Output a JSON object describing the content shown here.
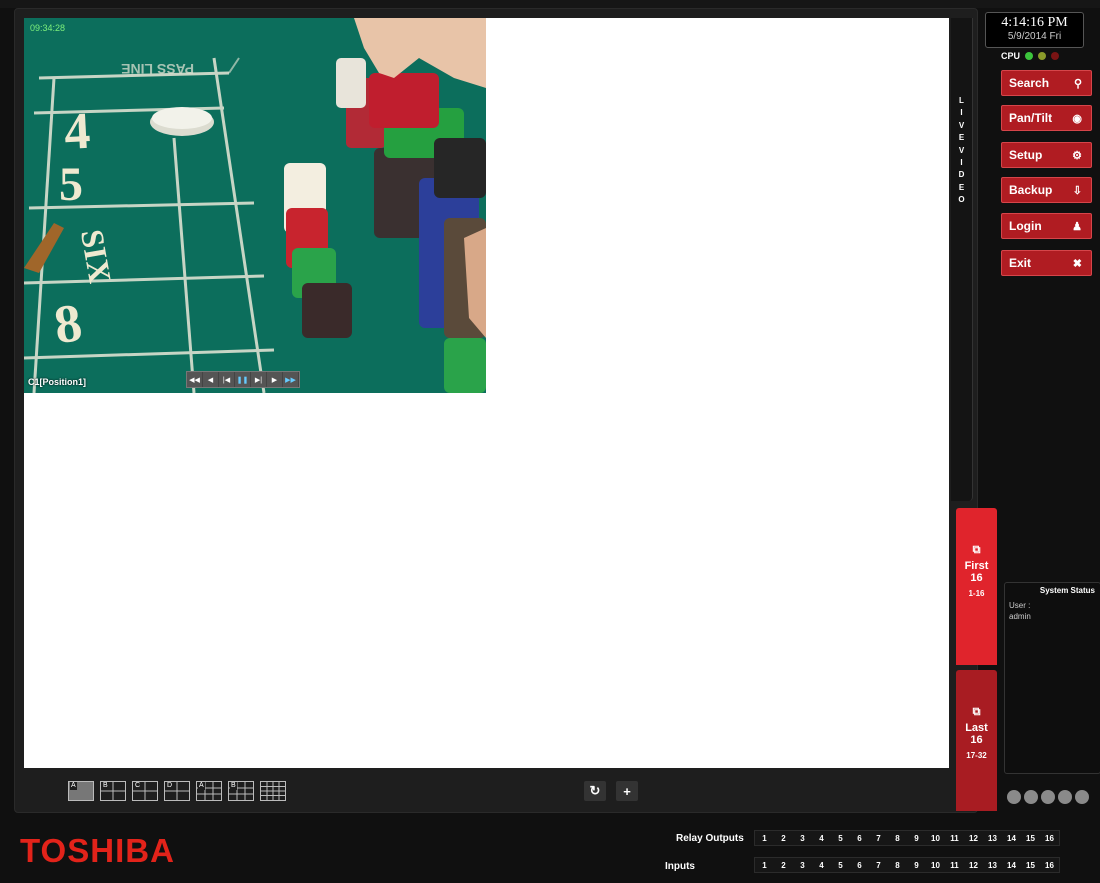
{
  "camera": {
    "timestamp": "09:34:28",
    "label": "C1[Position1]",
    "playback_controls": [
      {
        "icon": "fast-rewind-icon",
        "glyph": "◀◀"
      },
      {
        "icon": "play-reverse-icon",
        "glyph": "◀"
      },
      {
        "icon": "step-back-icon",
        "glyph": "|◀"
      },
      {
        "icon": "pause-icon",
        "glyph": "❚❚"
      },
      {
        "icon": "step-forward-icon",
        "glyph": "▶|"
      },
      {
        "icon": "play-icon",
        "glyph": "▶"
      },
      {
        "icon": "fast-forward-icon",
        "glyph": "▶▶"
      }
    ]
  },
  "live_label": "L I V E V I D E O",
  "clock": {
    "time": "4:14:16 PM",
    "date": "5/9/2014 Fri"
  },
  "cpu": {
    "label": "CPU",
    "leds": [
      "#3cc43c",
      "#8a9a2a",
      "#7a1414"
    ]
  },
  "menu": [
    {
      "label": "Search",
      "icon": "search-icon",
      "glyph": "⚲"
    },
    {
      "label": "Pan/Tilt",
      "icon": "eye-icon",
      "glyph": "◉"
    },
    {
      "label": "Setup",
      "icon": "gear-icon",
      "glyph": "⚙"
    },
    {
      "label": "Backup",
      "icon": "download-icon",
      "glyph": "⇩"
    },
    {
      "label": "Login",
      "icon": "user-icon",
      "glyph": "♟"
    },
    {
      "label": "Exit",
      "icon": "close-icon",
      "glyph": "✖"
    }
  ],
  "pages": {
    "first": {
      "title": "First",
      "count": "16",
      "range": "1-16",
      "icon": "page-stack-icon"
    },
    "last": {
      "title": "Last",
      "count": "16",
      "range": "17-32",
      "icon": "page-stack-icon"
    }
  },
  "system_status": {
    "title": "System Status",
    "user_label": "User :",
    "user_value": "admin"
  },
  "layouts": [
    {
      "name": "A",
      "icon": "layout-single-icon",
      "selected": true
    },
    {
      "name": "B",
      "icon": "layout-quad-icon"
    },
    {
      "name": "C",
      "icon": "layout-quad-icon"
    },
    {
      "name": "D",
      "icon": "layout-quad-icon"
    },
    {
      "name": "A",
      "icon": "layout-nine-icon"
    },
    {
      "name": "B",
      "icon": "layout-nine-icon"
    },
    {
      "name": "",
      "icon": "layout-sixteen-icon"
    }
  ],
  "tools": {
    "refresh_glyph": "↻",
    "add_glyph": "+"
  },
  "brand": "TOSHIBA",
  "relay_outputs": {
    "label": "Relay Outputs",
    "channels": [
      "1",
      "2",
      "3",
      "4",
      "5",
      "6",
      "7",
      "8",
      "9",
      "10",
      "11",
      "12",
      "13",
      "14",
      "15",
      "16"
    ]
  },
  "inputs": {
    "label": "Inputs",
    "channels": [
      "1",
      "2",
      "3",
      "4",
      "5",
      "6",
      "7",
      "8",
      "9",
      "10",
      "11",
      "12",
      "13",
      "14",
      "15",
      "16"
    ]
  }
}
